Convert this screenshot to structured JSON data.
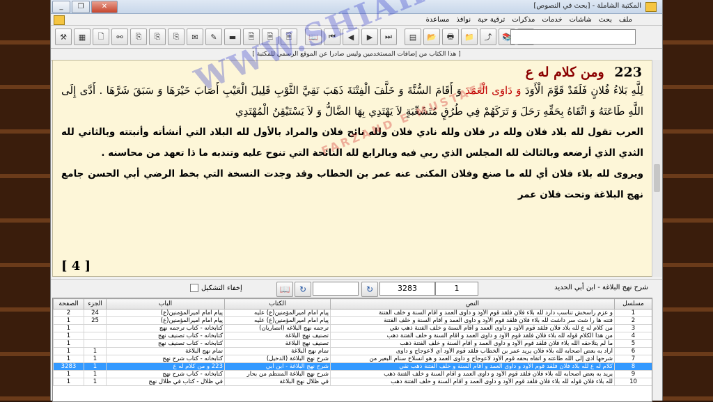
{
  "window": {
    "title": "المكتبة الشاملة - [بحث في النصوص]",
    "min_glyph": "_",
    "restore_glyph": "❐",
    "close_glyph": "✕"
  },
  "menu": [
    "ملف",
    "بحث",
    "شاشات",
    "خدمات",
    "مذكرات",
    "ترقية حية",
    "نوافذ",
    "مساعدة"
  ],
  "notice": "[ هذا الكتاب من إضافات المستخدمين وليس صادرا عن الموقع الرسمي للمكتبة ]",
  "reader": {
    "heading_number": "223",
    "heading_text": "ومن كلام له ع",
    "quote_part1": "لِلَّهِ بَلاءُ فُلانٍ فَلَقَدْ قَوَّمَ الْأَوَدَ ",
    "quote_highlight": "وَ دَاوَى الْعَمَدَ",
    "quote_part2": " وَ أَقَامَ السُّنَّةَ وَ خَلَّفَ الْفِتْنَةَ ذَهَبَ نَقِيَّ الثَّوْبِ قَلِيلَ الْعَيْبِ أَصَابَ خَيْرَهَا وَ سَبَقَ شَرَّهَا . أَدَّى إِلَى اللَّهِ طَاعَتَهُ وَ اتَّقَاهُ بِحَقِّهِ رَحَلَ وَ تَرَكَهُمْ فِي طُرُقٍ مُتَشَعِّبَةٍ لاَ يَهْتَدِي بِهَا الضَّالُّ وَ لاَ يَسْتَيْقِنُ الْمُهْتَدِي",
    "explanation1": "العرب تقول لله بلاد فلان ولله در فلان ولله نادي فلان ولله نائح فلان والمراد بالأول لله البلاد التي أنشأته وأنبتته وبالثاني لله الثدي الذي أرضعه وبالثالث لله المجلس الذي ربي فيه وبالرابع لله النائحة التي تنوح عليه وتندبه ما ذا تعهد من محاسنه .",
    "explanation2": "ويروى لله بلاء فلان أي لله ما صنع وفلان المكنى عنه عمر بن الخطاب وقد وجدت النسخة التي بخط الرضي أبي الحسن جامع نهج البلاغة وتحت فلان عمر",
    "page_number": "[ 4 ]"
  },
  "watermark": {
    "main": "WWW.SHIAHAQ.COM",
    "sub": "FARZAND E MUSTAFA"
  },
  "controls": {
    "book_name": "شرح نهج البلاغة - ابن أبي الحديد",
    "part_value": "1",
    "page_value": "3283",
    "hide_diacritics_label": "إخفاء التشكيل",
    "refresh_glyph": "↻",
    "book_glyph": "📖"
  },
  "grid": {
    "headers": [
      "مسلسل",
      "النص",
      "الكتاب",
      "الباب",
      "الجزء",
      "الصفحة"
    ],
    "rows": [
      {
        "n": "1",
        "text": "و عزم راسخش تناسب دارد لله بلاء فلان فلقد قوم الأود و داوى العمد و أقام السنة و خلف الفتنة",
        "book": "پیام امام امیرالمؤمنین(ع) علیه",
        "chapter": "پیام امام امیرالمؤمنین(ع)",
        "part": "24",
        "page": "2"
      },
      {
        "n": "2",
        "text": "فتنه ها را شت سر داشت لله بلاء فلان فلقد قوم الأود و داوى العمد و أقام السنة و خلف الفتنة",
        "book": "پیام امام امیرالمؤمنین(ع) علیه",
        "chapter": "پیام امام امیرالمؤمنین(ع)",
        "part": "25",
        "page": "1"
      },
      {
        "n": "3",
        "text": "من كلام له ع لله بلاد فلان فلقد قوم الأود و داوى العمد و أقام السنة و خلف الفتنة ذهب نقي",
        "book": "ترجمه نهج البلاغه (انصاريان)",
        "chapter": "کتابخانه - کتاب ترجمه نهج",
        "part": "",
        "page": "1"
      },
      {
        "n": "4",
        "text": "من هذا الكلام قوله لله بلاء فلان فلقد قوم الأود و داوى العمد و أقام السنة و خلف الفتنة ذهب",
        "book": "تصنيف نهج البلاغة",
        "chapter": "کتابخانه - کتاب تصنیف نهج",
        "part": "",
        "page": "1"
      },
      {
        "n": "5",
        "text": "ما لم يتلاحقه الله بلاء فلان فلقد قوم الأود و داوى العمد و أقام السنة و خلف الفتنة ذهب",
        "book": "تصنيف نهج البلاغة",
        "chapter": "کتابخانه - کتاب تصنیف نهج",
        "part": "",
        "page": "1"
      },
      {
        "n": "6",
        "text": "أراد به بعض أصحابه لله بلاء فلان يريد عمر بن الخطاب فلقد قوم الأود أي لاعوجاج و داوى",
        "book": "تمام نهج البلاغة",
        "chapter": "تمام نهج البلاغة",
        "part": "1",
        "page": "1"
      },
      {
        "n": "7",
        "text": "شرحها أدى إلى الله طاعته و اتقاه بحقه قوم الأود لاعوجاج و داوى العمد و هو انسلاخ سنام البعير من",
        "book": "شرح نهج البلاغة (الدخيل)",
        "chapter": "کتابخانه - کتاب شرح نهج",
        "part": "1",
        "page": "1"
      },
      {
        "n": "8",
        "text": "كلام له ع لله بلاد فلان فلقد قوم الأود و داوى العمد و أقام السنة و خلف الفتنة ذهب نقي",
        "book": "شرح نهج البلاغة - ابن أبي",
        "chapter": "223 و من كلام له ع",
        "part": "1",
        "page": "3283"
      },
      {
        "n": "9",
        "text": "يريد به بعض أصحابه لله بلاء فلان فلقد قوم الأود و داوى العمد و أقام السنة و خلف الفتنة ذهب",
        "book": "شرح نهج البلاغة المنتظم من بحار",
        "chapter": "کتابخانه - کتاب شرح نهج",
        "part": "1",
        "page": "1"
      },
      {
        "n": "10",
        "text": "لله بلاء فلان قوله لله بلاء فلان فلقد قوم الأود و داوى العمد و أقام السنة و خلف الفتنة ذهب",
        "book": "في ظلال نهج البلاغة",
        "chapter": "في ظلال - كتاب في ظلال نهج",
        "part": "1",
        "page": "1"
      }
    ],
    "selected_index": 7
  },
  "toolbar": [
    "tools-icon",
    "grid-icon",
    "new-doc-icon",
    "binoculars-icon",
    "copy-icon",
    "copy2-icon",
    "copy3-icon",
    "note-icon",
    "pencil-icon",
    "marker-icon",
    "doc-a-icon",
    "doc-b-icon",
    "doc-c-icon",
    "open-book-icon",
    "first-icon",
    "prev-icon",
    "next-icon",
    "last-icon",
    "books-icon",
    "folder-open-icon",
    "printer-icon",
    "folder-icon",
    "export-icon",
    "books-stack-icon",
    "book-icon"
  ],
  "toolbar_glyphs": [
    "⚒",
    "▦",
    "🗋",
    "⚯",
    "⎘",
    "⎘",
    "⎘",
    "✉",
    "✎",
    "▬",
    "🗎",
    "🗎",
    "🗎",
    "📖",
    "⏮",
    "◀",
    "▶",
    "⏭",
    "▤",
    "📂",
    "🖶",
    "📁",
    "⤴",
    "📚",
    "📕"
  ]
}
